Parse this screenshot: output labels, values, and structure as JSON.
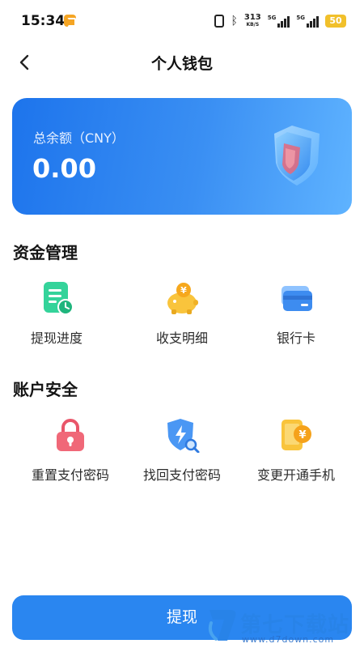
{
  "status_bar": {
    "time": "15:34",
    "speed_value": "313",
    "speed_unit": "KB/S",
    "signal1_tag": "5G",
    "signal2_tag": "5G",
    "battery": "50",
    "icons": [
      "app-notification-icon",
      "vibrate-icon",
      "bluetooth-icon",
      "signal-icon",
      "battery-icon"
    ]
  },
  "nav": {
    "title": "个人钱包",
    "back_icon": "chevron-left-icon"
  },
  "balance": {
    "label": "总余额（CNY）",
    "value": "0.00"
  },
  "fund_section": {
    "title": "资金管理",
    "items": [
      {
        "label": "提现进度",
        "icon": "withdraw-progress-icon",
        "color": "#2fcf8f"
      },
      {
        "label": "收支明细",
        "icon": "piggy-bank-icon",
        "color": "#f8c23a"
      },
      {
        "label": "银行卡",
        "icon": "bank-card-icon",
        "color": "#3d8cf0"
      }
    ]
  },
  "security_section": {
    "title": "账户安全",
    "items": [
      {
        "label": "重置支付密码",
        "icon": "lock-icon",
        "color": "#f05a6a"
      },
      {
        "label": "找回支付密码",
        "icon": "shield-search-icon",
        "color": "#3d8cf0"
      },
      {
        "label": "变更开通手机",
        "icon": "phone-yuan-icon",
        "color": "#f8b92a"
      }
    ]
  },
  "withdraw_button": {
    "label": "提现"
  },
  "watermark": {
    "text": "第七下载站",
    "url": "www.d7down.com"
  },
  "colors": {
    "accent": "#2a86f0",
    "card_start": "#1d74ec",
    "card_end": "#5fb3ff"
  }
}
